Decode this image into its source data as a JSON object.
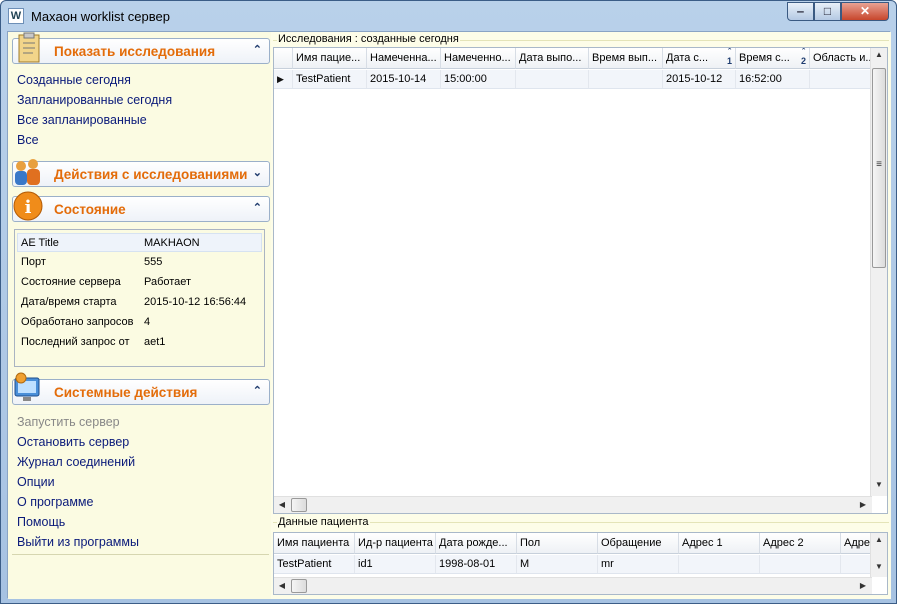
{
  "window": {
    "title": "Maxaoн worklist сервер",
    "app_icon": "W"
  },
  "window_controls": {
    "minimize": "‒",
    "maximize": "□",
    "close": "✕"
  },
  "sidebar": {
    "sections": [
      {
        "title": "Показать исследования",
        "chevron": "⌃",
        "icon": "clipboard-icon",
        "items": [
          "Созданные сегодня",
          "Запланированные сегодня",
          "Все запланированные",
          "Все"
        ]
      },
      {
        "title": "Действия с исследованиями",
        "chevron": "⌄",
        "icon": "people-icon",
        "items": []
      },
      {
        "title": "Состояние",
        "chevron": "⌃",
        "icon": "info-icon"
      },
      {
        "title": "Системные действия",
        "chevron": "⌃",
        "icon": "monitor-icon",
        "items": [
          "Запустить сервер",
          "Остановить сервер",
          "Журнал соединений",
          "Опции",
          "О программе",
          "Помощь",
          "Выйти из программы"
        ]
      }
    ],
    "status": [
      {
        "label": "AE Title",
        "value": "MAKHAON"
      },
      {
        "label": "Порт",
        "value": "555"
      },
      {
        "label": "Состояние сервера",
        "value": "Работает"
      },
      {
        "label": "Дата/время старта",
        "value": "2015-10-12 16:56:44"
      },
      {
        "label": "Обработано запросов",
        "value": "4"
      },
      {
        "label": "Последний запрос от",
        "value": "aet1"
      }
    ]
  },
  "studies": {
    "group_label": "Исследования : созданные сегодня",
    "columns": [
      "Имя пацие...",
      "Намеченна...",
      "Намеченно...",
      "Дата выпо...",
      "Время вып...",
      "Дата с...",
      "Время с...",
      "Область и..."
    ],
    "sort_marks": {
      "5": "1",
      "6": "2"
    },
    "rows": [
      [
        "TestPatient",
        "2015-10-14",
        "15:00:00",
        "",
        "",
        "2015-10-12",
        "16:52:00",
        ""
      ]
    ]
  },
  "patient": {
    "group_label": "Данные пациента",
    "columns": [
      "Имя пациента",
      "Ид-р пациента",
      "Дата рожде...",
      "Пол",
      "Обращение",
      "Адрес 1",
      "Адрес 2",
      "Адре"
    ],
    "rows": [
      [
        "TestPatient",
        "id1",
        "1998-08-01",
        "M",
        "mr",
        "",
        "",
        ""
      ]
    ]
  },
  "row_marker": "▶",
  "scroll_glyphs": {
    "up": "▲",
    "down": "▼",
    "left": "◀",
    "right": "▶",
    "grip": "≡"
  }
}
